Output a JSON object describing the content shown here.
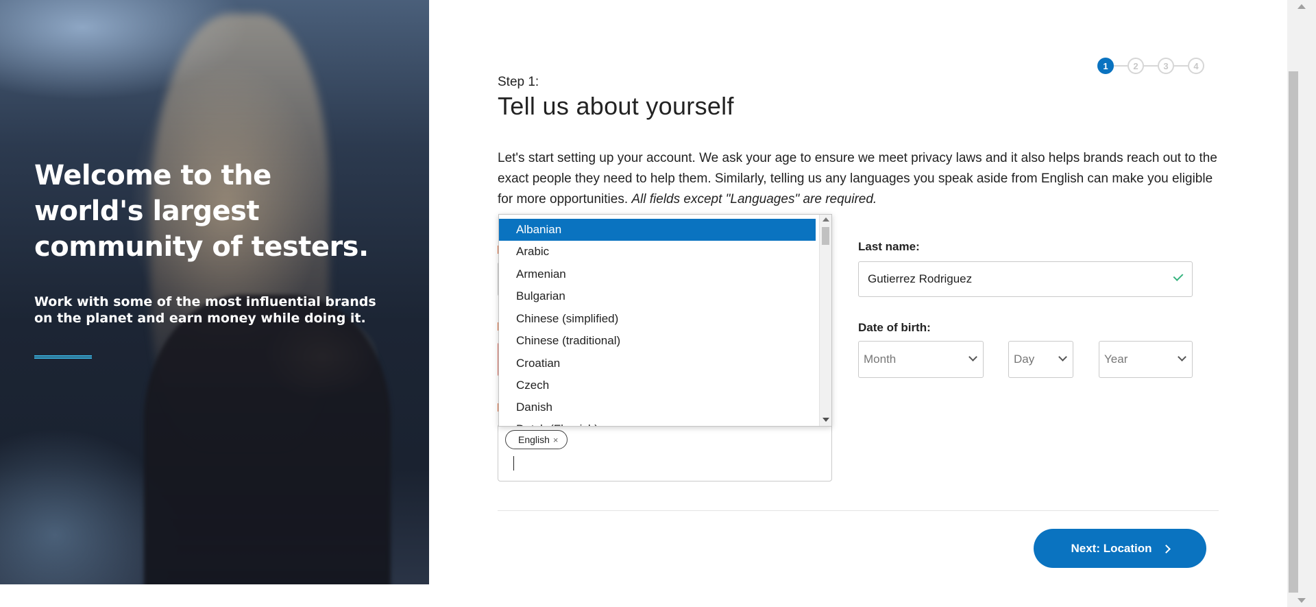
{
  "hero": {
    "title": "Welcome to the world's largest community of testers.",
    "subtitle": "Work with some of the most influential brands on the planet and earn money while doing it."
  },
  "stepper": {
    "steps": [
      "1",
      "2",
      "3",
      "4"
    ],
    "active": 1
  },
  "form": {
    "step_label": "Step 1:",
    "title": "Tell us about yourself",
    "intro": "Let's start setting up your account. We ask your age to ensure we meet privacy laws and it also helps brands reach out to the exact people they need to help them. Similarly, telling us any languages you speak aside from English can make you eligible for more opportunities.",
    "intro_note": "All fields except \"Languages\" are required.",
    "last_name_label": "Last name:",
    "last_name_value": "Gutierrez Rodriguez",
    "dob_label": "Date of birth:",
    "dob_month": "Month",
    "dob_day": "Day",
    "dob_year": "Year",
    "languages_selected": [
      "English"
    ],
    "chip_remove": "×"
  },
  "dropdown": {
    "options": [
      "Albanian",
      "Arabic",
      "Armenian",
      "Bulgarian",
      "Chinese (simplified)",
      "Chinese (traditional)",
      "Croatian",
      "Czech",
      "Danish",
      "Dutch (Flemish)"
    ],
    "highlighted": "Albanian"
  },
  "actions": {
    "next_label": "Next: Location"
  },
  "colors": {
    "primary": "#0a73c0",
    "success": "#36b37e",
    "error": "#e07060",
    "accent_line": "#39b2df"
  }
}
